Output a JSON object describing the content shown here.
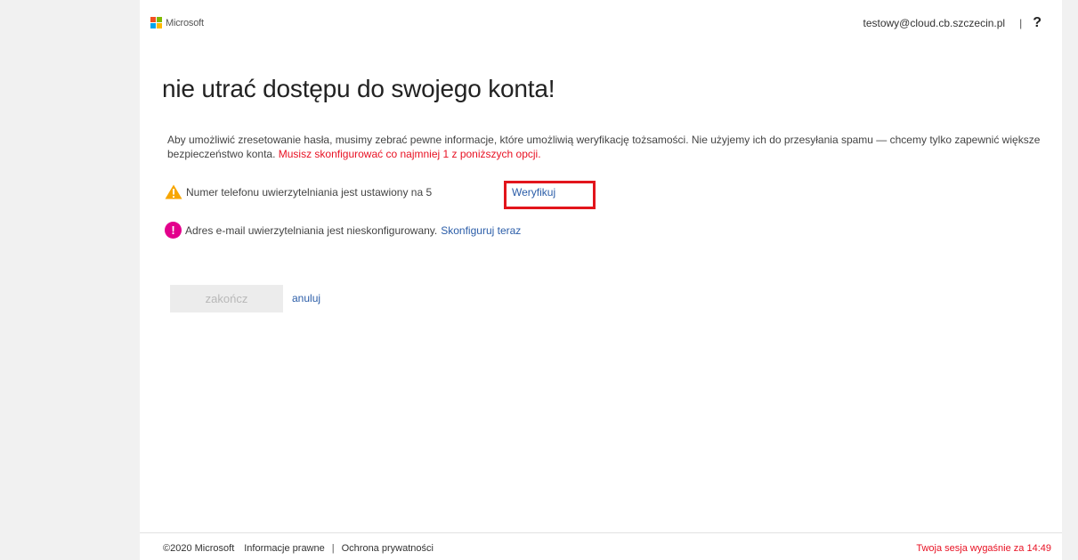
{
  "header": {
    "brand": "Microsoft",
    "user_email": "testowy@cloud.cb.szczecin.pl",
    "separator": "|",
    "help": "?"
  },
  "main": {
    "title": "nie utrać dostępu do swojego konta!",
    "intro": "Aby umożliwić zresetowanie hasła, musimy zebrać pewne informacje, które umożliwią weryfikację tożsamości. Nie użyjemy ich do przesyłania spamu — chcemy tylko zapewnić większe bezpieczeństwo konta.",
    "intro_warning": "Musisz skonfigurować co najmniej 1 z poniższych opcji.",
    "phone_status": "Numer telefonu uwierzytelniania jest ustawiony na 5",
    "verify_link": "Weryfikuj",
    "email_status": "Adres e-mail uwierzytelniania jest nieskonfigurowany.",
    "configure_link": "Skonfiguruj teraz",
    "finish_button": "zakończ",
    "cancel_link": "anuluj"
  },
  "footer": {
    "copyright": "©2020 Microsoft",
    "legal": "Informacje prawne",
    "separator": "|",
    "privacy": "Ochrona prywatności",
    "session": "Twoja sesja wygaśnie za 14:49"
  },
  "colors": {
    "logo_red": "#f25022",
    "logo_green": "#7fba00",
    "logo_blue": "#00a4ef",
    "logo_yellow": "#ffb900",
    "warning": "#e81123",
    "link": "#2b5da8",
    "highlight_box": "#e2151c",
    "error_icon": "#e3008c",
    "warning_icon": "#f7a600"
  },
  "icons": {
    "warning": "warning-triangle-icon",
    "error": "exclamation-circle-icon",
    "help": "help-icon"
  }
}
